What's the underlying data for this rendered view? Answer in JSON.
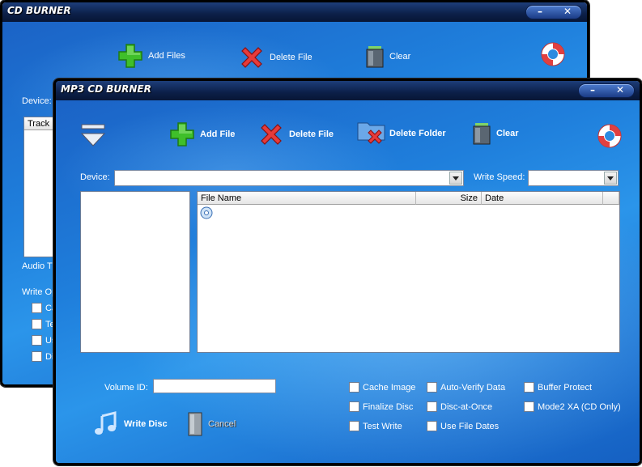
{
  "back_window": {
    "title": "CD BURNER",
    "toolbar": {
      "add_files": "Add Files",
      "delete_file": "Delete File",
      "clear": "Clear"
    },
    "device_label": "Device:",
    "track_header": "Track",
    "audio_label": "Audio Tr",
    "write_options_label": "Write Op",
    "checkbox_labels": [
      "Ca",
      "Te",
      "Us",
      "Dis"
    ]
  },
  "front_window": {
    "title": "MP3 CD BURNER",
    "toolbar": {
      "add_file": "Add File",
      "delete_file": "Delete File",
      "delete_folder": "Delete Folder",
      "clear": "Clear"
    },
    "device_label": "Device:",
    "device_value": "",
    "write_speed_label": "Write Speed:",
    "write_speed_value": "",
    "file_table": {
      "columns": [
        "File Name",
        "Size",
        "Date"
      ],
      "rows": []
    },
    "volume_id_label": "Volume ID:",
    "volume_id_value": "",
    "options": [
      {
        "label": "Cache Image",
        "checked": false
      },
      {
        "label": "Auto-Verify Data",
        "checked": false
      },
      {
        "label": "Buffer Protect",
        "checked": false
      },
      {
        "label": "Finalize Disc",
        "checked": false
      },
      {
        "label": "Disc-at-Once",
        "checked": false
      },
      {
        "label": "Mode2 XA (CD Only)",
        "checked": false
      },
      {
        "label": "Test Write",
        "checked": false
      },
      {
        "label": "Use File Dates",
        "checked": false
      }
    ],
    "write_disc_label": "Write Disc",
    "cancel_label": "Cancel"
  },
  "window_controls": {
    "minimize": "–",
    "close": "✕"
  },
  "colors": {
    "titlebar": "#0c1f48",
    "accent": "#1f7fdc"
  }
}
